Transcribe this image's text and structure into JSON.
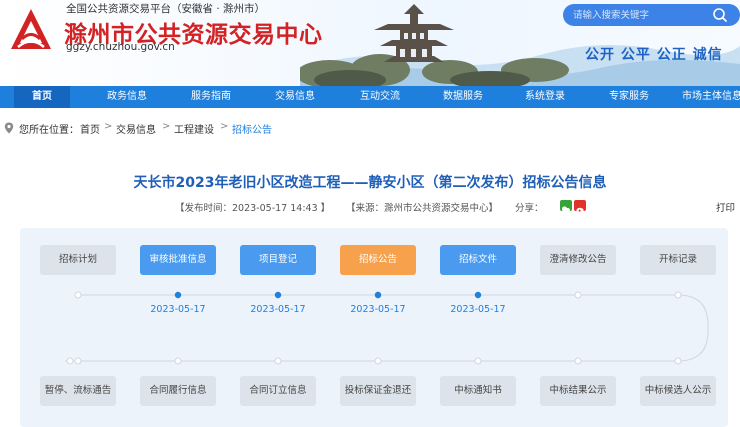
{
  "header": {
    "tagline": "全国公共资源交易平台（安徽省 · 滁州市）",
    "site_name": "滁州市公共资源交易中心",
    "domain": "ggzy.chuzhou.gov.cn",
    "search_placeholder": "请输入搜索关键字",
    "slogan": "公开 公平 公正 诚信",
    "colors": {
      "brand_red": "#d32224",
      "nav_blue": "#1f7fdc",
      "accent_orange": "#f8a14c"
    }
  },
  "nav": {
    "items": [
      "首页",
      "政务信息",
      "服务指南",
      "交易信息",
      "互动交流",
      "数据服务",
      "系统登录",
      "专家服务",
      "市场主体信息"
    ],
    "active_index": 0
  },
  "breadcrumb": {
    "prefix": "您所在位置：",
    "items": [
      "首页",
      "交易信息",
      "工程建设",
      "招标公告"
    ],
    "separator": ">"
  },
  "article": {
    "title": "天长市2023年老旧小区改造工程——静安小区（第二次发布）招标公告信息",
    "publish_time": "【发布时间：2023-05-17 14:43 】",
    "source": "【来源：滁州市公共资源交易中心】",
    "share_label": "分享：",
    "print_label": "打印"
  },
  "process": {
    "top_steps": [
      {
        "label": "招标计划",
        "state": "inactive"
      },
      {
        "label": "审核批准信息",
        "state": "done"
      },
      {
        "label": "项目登记",
        "state": "done"
      },
      {
        "label": "招标公告",
        "state": "current"
      },
      {
        "label": "招标文件",
        "state": "done"
      },
      {
        "label": "澄清修改公告",
        "state": "inactive"
      },
      {
        "label": "开标记录",
        "state": "inactive"
      }
    ],
    "dates": [
      "2023-05-17",
      "2023-05-17",
      "2023-05-17",
      "2023-05-17"
    ],
    "bottom_steps": [
      {
        "label": "暂停、流标通告"
      },
      {
        "label": "合同履行信息"
      },
      {
        "label": "合同订立信息"
      },
      {
        "label": "投标保证金退还"
      },
      {
        "label": "中标通知书"
      },
      {
        "label": "中标结果公示"
      },
      {
        "label": "中标候选人公示"
      }
    ]
  }
}
